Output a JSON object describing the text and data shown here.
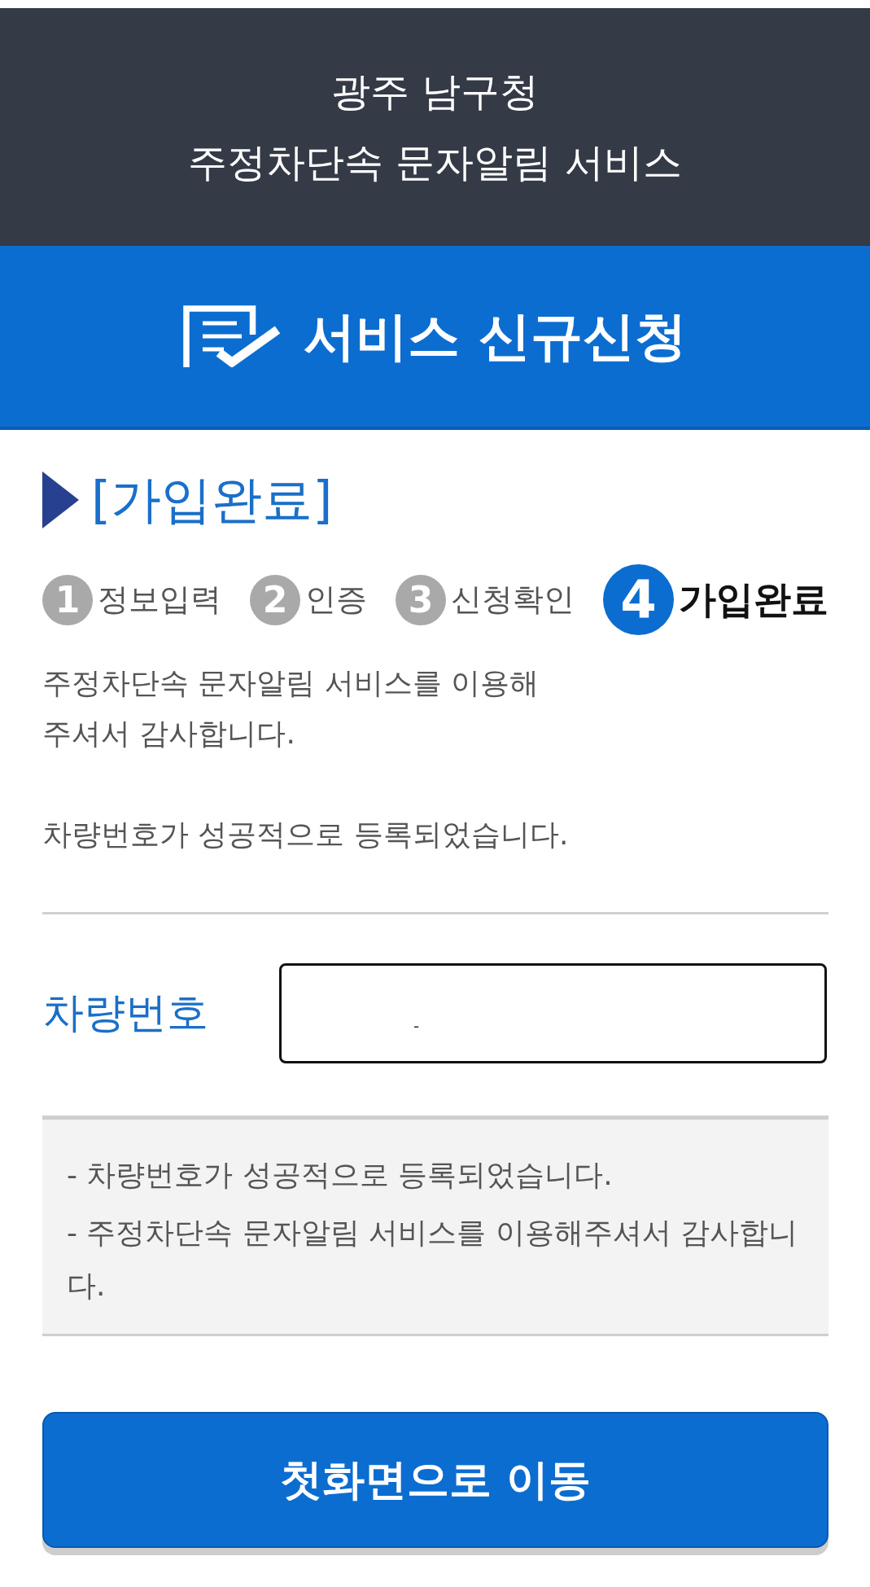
{
  "header": {
    "agency": "광주 남구청",
    "service": "주정차단속 문자알림 서비스"
  },
  "banner": {
    "title": "서비스 신규신청"
  },
  "section": {
    "title": "[가입완료]"
  },
  "steps": [
    {
      "number": "1",
      "label": "정보입력",
      "selected": false
    },
    {
      "number": "2",
      "label": "인증",
      "selected": false
    },
    {
      "number": "3",
      "label": "신청확인",
      "selected": false
    },
    {
      "number": "4",
      "label": "가입완료",
      "selected": true
    }
  ],
  "message": {
    "paragraphs": [
      "주정차단속 문자알림 서비스를 이용해\n주셔서 감사합니다.",
      "차량번호가 성공적으로 등록되었습니다."
    ]
  },
  "plate": {
    "label": "차량번호",
    "value": "-"
  },
  "notice": {
    "items": [
      "- 차량번호가 성공적으로 등록되었습니다.",
      "- 주정차단속 문자알림 서비스를 이용해주셔서 감사합니다."
    ]
  },
  "home_button": {
    "label": "첫화면으로 이동"
  }
}
